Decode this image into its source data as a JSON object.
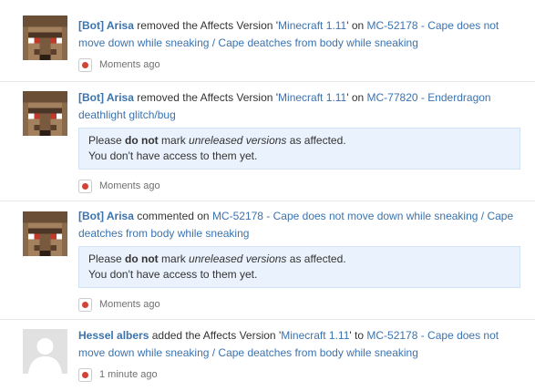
{
  "activity": [
    {
      "author": "[Bot] Arisa",
      "avatar": "villager-avatar",
      "parts": [
        " removed the Affects Version '",
        "Minecraft 1.11",
        "' on "
      ],
      "issue": "MC-52178 - Cape does not move down while sneaking / Cape deatches from body while sneaking",
      "comment": null,
      "time": "Moments ago"
    },
    {
      "author": "[Bot] Arisa",
      "avatar": "villager-avatar",
      "parts": [
        " removed the Affects Version '",
        "Minecraft 1.11",
        "' on "
      ],
      "issue": "MC-77820 - Enderdragon deathlight glitch/bug",
      "comment": {
        "pre": "Please ",
        "bold": "do not",
        "mid": " mark ",
        "italic": "unreleased versions",
        "post": " as affected.",
        "line2": "You don't have access to them yet."
      },
      "time": "Moments ago"
    },
    {
      "author": "[Bot] Arisa",
      "avatar": "villager-avatar",
      "parts": [
        " commented on "
      ],
      "issue": "MC-52178 - Cape does not move down while sneaking / Cape deatches from body while sneaking",
      "comment": {
        "pre": "Please ",
        "bold": "do not",
        "mid": " mark ",
        "italic": "unreleased versions",
        "post": " as affected.",
        "line2": "You don't have access to them yet."
      },
      "time": "Moments ago"
    },
    {
      "author": "Hessel albers",
      "avatar": "default-avatar",
      "parts": [
        " added the Affects Version '",
        "Minecraft 1.11",
        "' to "
      ],
      "issue": "MC-52178 - Cape does not move down while sneaking / Cape deatches from body while sneaking",
      "comment": null,
      "time": "1 minute ago"
    }
  ],
  "colors": {
    "link": "#3b73af",
    "quote_bg": "#e9f2fd",
    "meta_icon": "#d04437"
  }
}
